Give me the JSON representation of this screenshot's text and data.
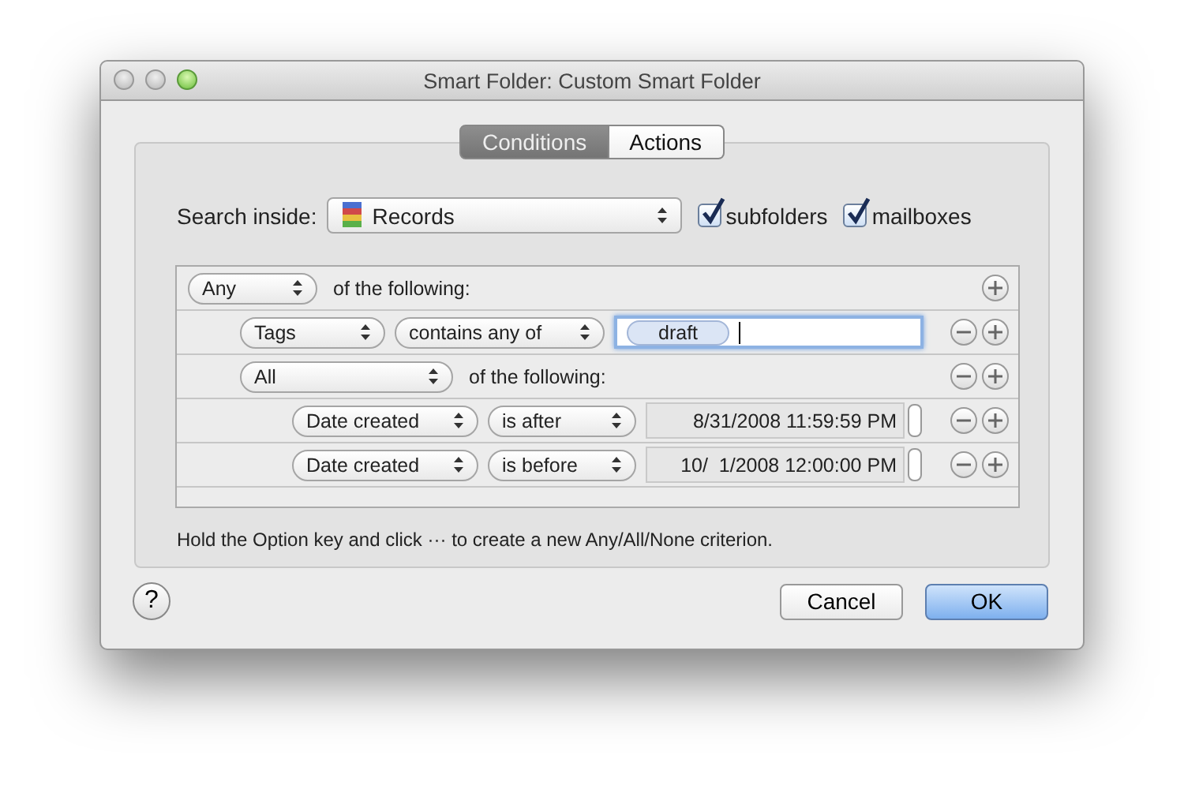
{
  "window": {
    "title": "Smart Folder: Custom Smart Folder"
  },
  "tabs": [
    {
      "label": "Conditions",
      "selected": true
    },
    {
      "label": "Actions",
      "selected": false
    }
  ],
  "search_inside": {
    "label": "Search inside:",
    "value": "Records",
    "options": [
      {
        "label": "subfolders",
        "checked": true
      },
      {
        "label": "mailboxes",
        "checked": true
      }
    ]
  },
  "criteria": {
    "kind": "group",
    "match": "Any",
    "suffix": "of the following:",
    "children": [
      {
        "kind": "text",
        "field": "Tags",
        "operator": "contains any of",
        "tokens": [
          "draft"
        ],
        "focused": true
      },
      {
        "kind": "group",
        "match": "All",
        "suffix": "of the following:",
        "children": [
          {
            "kind": "date",
            "field": "Date created",
            "operator": "is after",
            "value": "8/31/2008 11:59:59 PM"
          },
          {
            "kind": "date",
            "field": "Date created",
            "operator": "is before",
            "value": "10/  1/2008 12:00:00 PM"
          }
        ]
      }
    ]
  },
  "hint": "Hold the Option key and click ··· to create a new Any/All/None criterion.",
  "help": "?",
  "buttons": [
    {
      "label": "Cancel",
      "default": false
    },
    {
      "label": "OK",
      "default": true
    }
  ]
}
